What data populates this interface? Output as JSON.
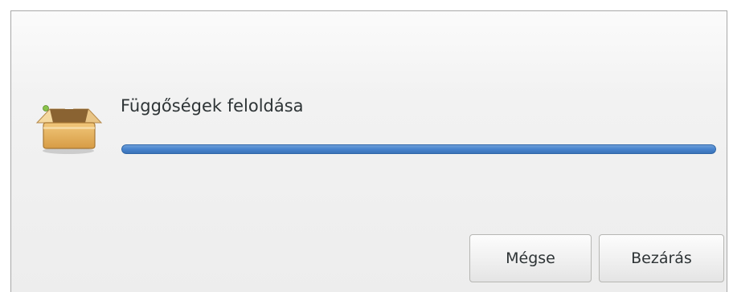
{
  "dialog": {
    "title": "Függőségek feloldása",
    "icon": "package-box-icon",
    "progress_fraction": 1.0
  },
  "buttons": {
    "cancel_label": "Mégse",
    "close_label": "Bezárás"
  },
  "colors": {
    "progress_fill": "#4a86cf",
    "title_text": "#2e3436"
  }
}
